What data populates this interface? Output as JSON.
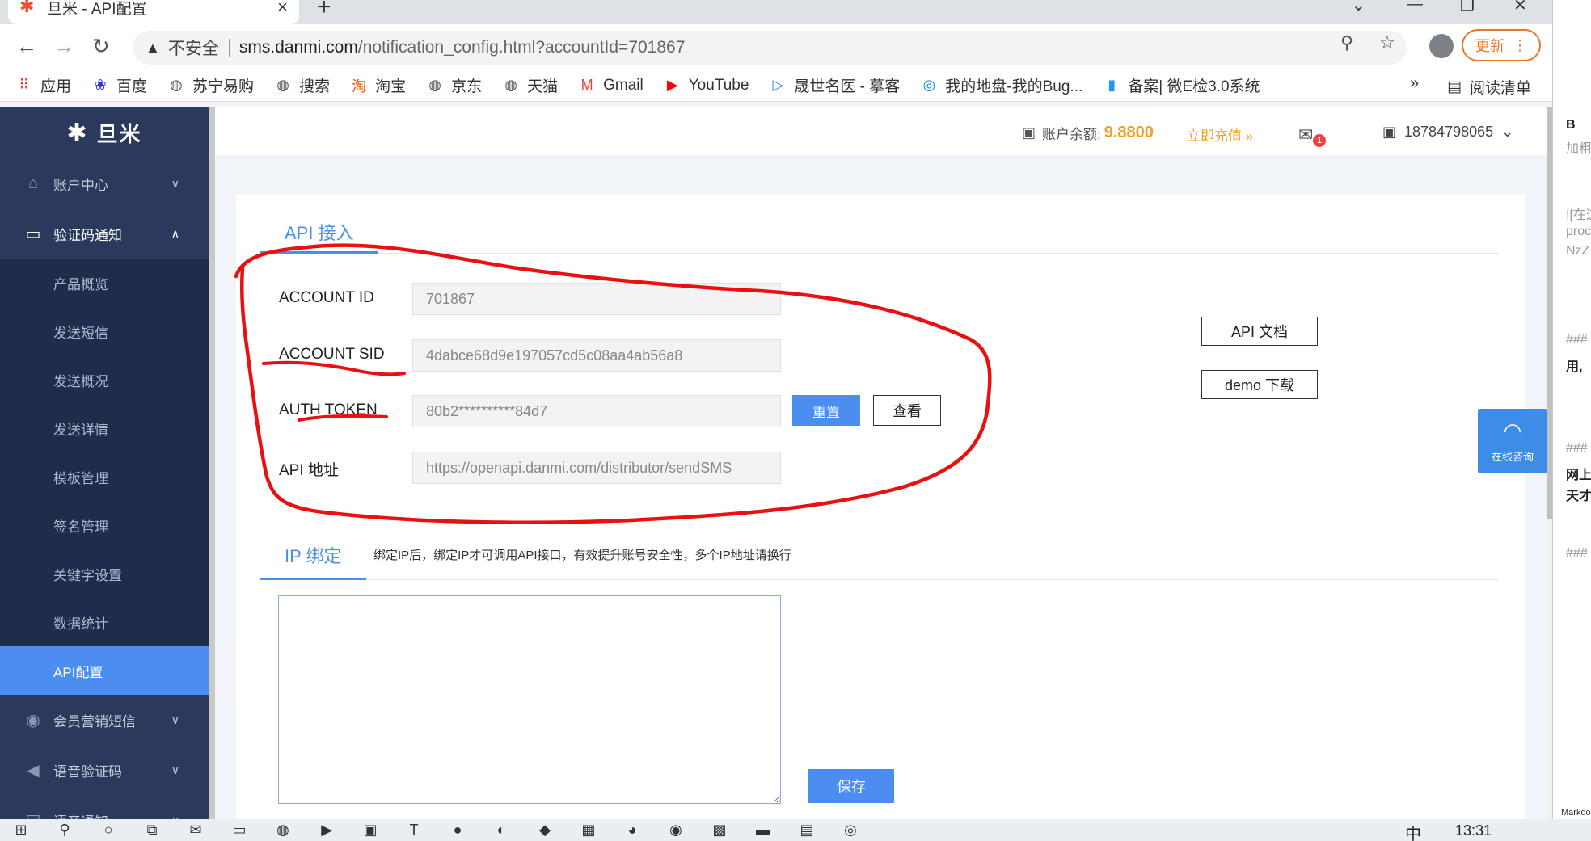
{
  "browser": {
    "tab_title": "旦米 - API配置",
    "insecure_label": "不安全",
    "url_host": "sms.danmi.com",
    "url_rest": "/notification_config.html?accountId=701867",
    "update_label": "更新",
    "bookmarks": [
      {
        "label": "应用",
        "icon": "apps-grid-icon",
        "color": "#e94235"
      },
      {
        "label": "百度",
        "icon": "baidu-paw-icon",
        "color": "#2932e1"
      },
      {
        "label": "苏宁易购",
        "icon": "globe-icon",
        "color": "#555555"
      },
      {
        "label": "搜索",
        "icon": "globe-icon",
        "color": "#555555"
      },
      {
        "label": "淘宝",
        "icon": "taobao-icon",
        "color": "#ff5000"
      },
      {
        "label": "京东",
        "icon": "globe-icon",
        "color": "#555555"
      },
      {
        "label": "天猫",
        "icon": "globe-icon",
        "color": "#555555"
      },
      {
        "label": "Gmail",
        "icon": "gmail-icon",
        "color": "#ea4335"
      },
      {
        "label": "YouTube",
        "icon": "youtube-icon",
        "color": "#ff0000"
      },
      {
        "label": "晟世名医 - 摹客",
        "icon": "play-triangle-icon",
        "color": "#2f86f6"
      },
      {
        "label": "我的地盘-我的Bug...",
        "icon": "swirl-icon",
        "color": "#1e88e5"
      },
      {
        "label": "备案| 微E检3.0系统",
        "icon": "bars-logo-icon",
        "color": "#2196f3"
      }
    ],
    "more_label": "»",
    "reading_list_label": "阅读清单"
  },
  "header": {
    "balance_label": "账户余额:",
    "balance_value": "9.8800",
    "recharge_label": "立即充值 »",
    "mail_badge": "1",
    "user_phone": "18784798065"
  },
  "sidebar": {
    "logo": "旦米",
    "menu_account": "账户中心",
    "menu_verify": "验证码通知",
    "sub_items": [
      "产品概览",
      "发送短信",
      "发送概况",
      "发送详情",
      "模板管理",
      "签名管理",
      "关键字设置",
      "数据统计",
      "API配置"
    ],
    "active_index": 8,
    "menu_member": "会员营销短信",
    "menu_voice": "语音验证码",
    "menu_voice_notice": "语音通知"
  },
  "api": {
    "tab_label": "API 接入",
    "fields": [
      {
        "label": "ACCOUNT ID",
        "value": "701867"
      },
      {
        "label": "ACCOUNT SID",
        "value": "4dabce68d9e197057cd5c08aa4ab56a8"
      },
      {
        "label": "AUTH TOKEN",
        "value": "80b2**********84d7"
      },
      {
        "label": "API 地址",
        "value": "https://openapi.danmi.com/distributor/sendSMS"
      }
    ],
    "reset_label": "重置",
    "view_label": "查看",
    "doc_label": "API 文档",
    "demo_label": "demo 下载"
  },
  "ip": {
    "tab_label": "IP 绑定",
    "hint": "绑定IP后，绑定IP才可调用API接口，有效提升账号安全性，多个IP地址请换行",
    "value": "",
    "save_label": "保存"
  },
  "support": {
    "label": "在线咨询"
  },
  "taskbar": {
    "ime": "中",
    "time": "13:31"
  },
  "side_window": {
    "lines": [
      "B",
      "加粗",
      "![在这",
      "proc",
      "NzZ",
      "###",
      "用,",
      "###",
      "网上",
      "天才",
      "###",
      "Markdo"
    ]
  },
  "colors": {
    "accent": "#4c8ef0",
    "sidebar": "#2b3a5c",
    "balance": "#f0a020",
    "annotation": "#e81010"
  }
}
